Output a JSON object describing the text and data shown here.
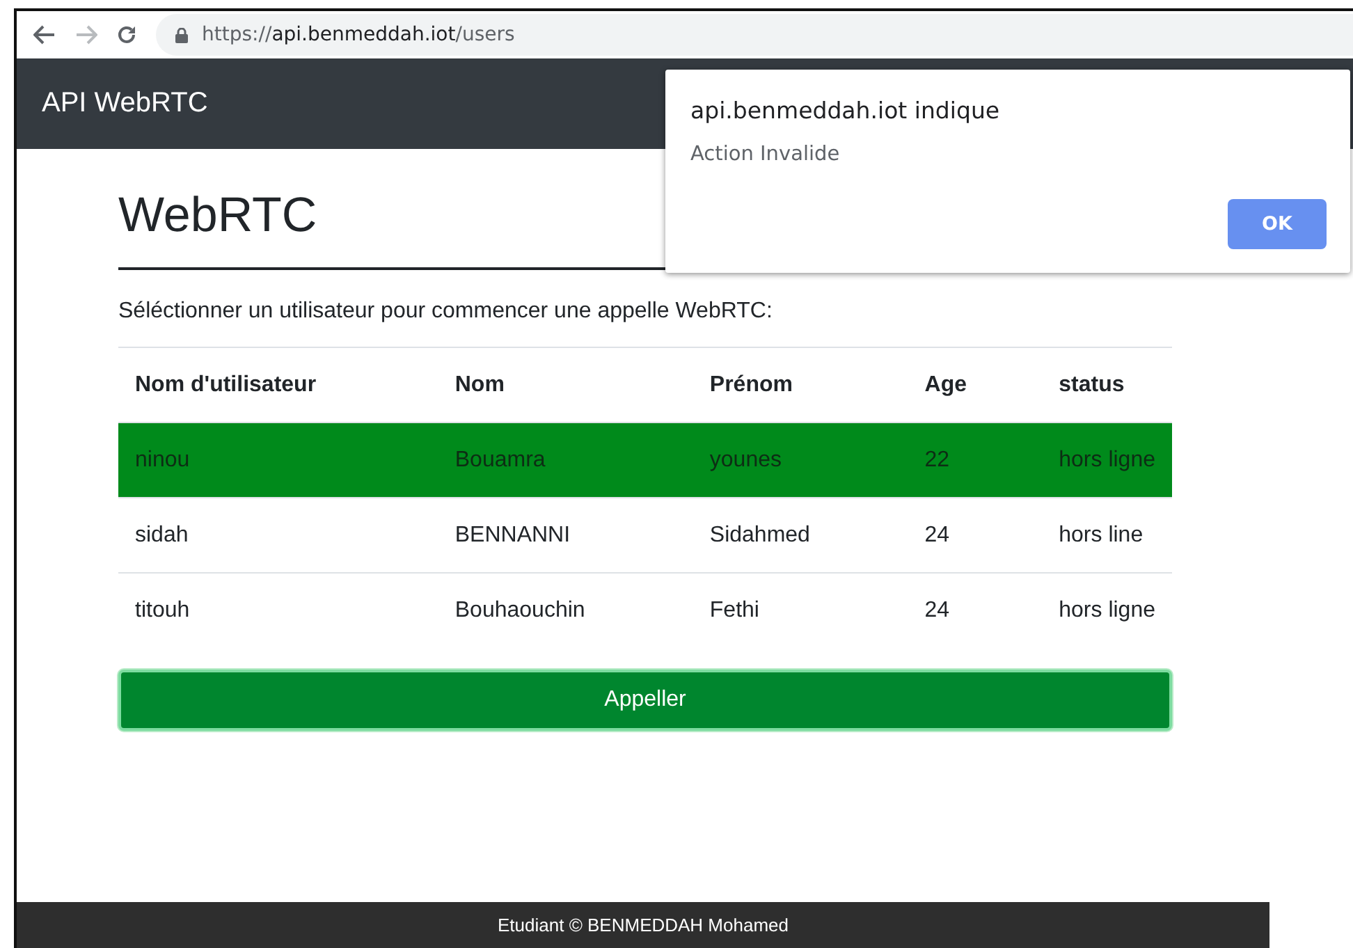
{
  "browser": {
    "url": {
      "scheme": "https://",
      "host": "api.benmeddah.iot",
      "path": "/users"
    }
  },
  "navbar": {
    "brand": "API WebRTC"
  },
  "page": {
    "heading": "WebRTC",
    "intro": "Séléctionner un utilisateur pour commencer une appelle WebRTC:"
  },
  "table": {
    "columns": [
      "Nom d'utilisateur",
      "Nom",
      "Prénom",
      "Age",
      "status"
    ],
    "rows": [
      {
        "cells": [
          "ninou",
          "Bouamra",
          "younes",
          "22",
          "hors ligne"
        ],
        "selected": true
      },
      {
        "cells": [
          "sidah",
          "BENNANNI",
          "Sidahmed",
          "24",
          "hors line"
        ],
        "selected": false
      },
      {
        "cells": [
          "titouh",
          "Bouhaouchin",
          "Fethi",
          "24",
          "hors ligne"
        ],
        "selected": false
      }
    ]
  },
  "call_button": "Appeller",
  "footer": "Etudiant © BENMEDDAH Mohamed",
  "dialog": {
    "title": "api.benmeddah.iot indique",
    "message": "Action Invalide",
    "button": "OK"
  }
}
